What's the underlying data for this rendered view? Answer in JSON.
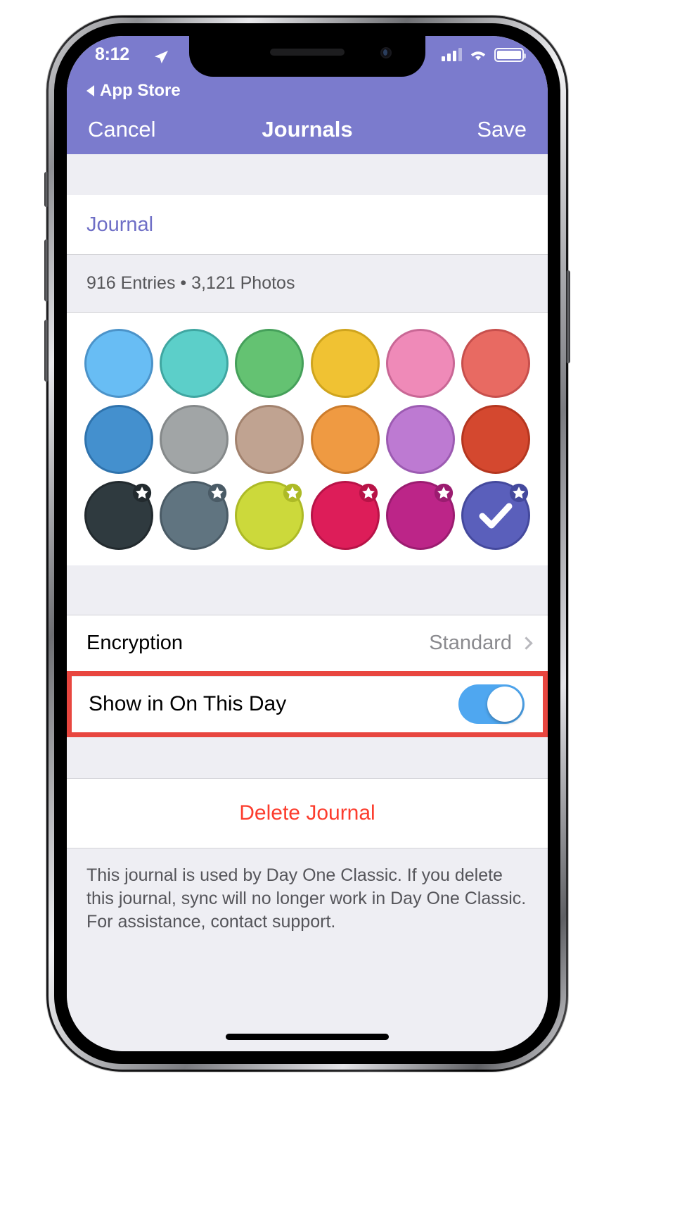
{
  "status_bar": {
    "time": "8:12",
    "location_icon": "location-arrow-icon",
    "signal_icon": "cellular-signal-icon",
    "wifi_icon": "wifi-icon",
    "battery_icon": "battery-full-icon"
  },
  "back_link": {
    "label": "App Store",
    "icon": "back-caret-icon"
  },
  "nav_bar": {
    "cancel_label": "Cancel",
    "title": "Journals",
    "save_label": "Save",
    "background_color": "#7b7bcd"
  },
  "journal": {
    "name": "Journal",
    "name_color": "#6f6fc6",
    "stats": "916 Entries • 3,121 Photos",
    "entries_count": "916",
    "photos_count": "3,121"
  },
  "color_picker": {
    "selected_index": 17,
    "check_icon": "checkmark-icon",
    "swatches": [
      {
        "name": "sky-blue",
        "color": "#68bdf4",
        "border": "#4b93c9",
        "premium": false
      },
      {
        "name": "turquoise",
        "color": "#5ccfc9",
        "border": "#3fa6a1",
        "premium": false
      },
      {
        "name": "green",
        "color": "#64c272",
        "border": "#45a05a",
        "premium": false
      },
      {
        "name": "yellow",
        "color": "#f0c233",
        "border": "#cfa41d",
        "premium": false
      },
      {
        "name": "pink",
        "color": "#ef8ab8",
        "border": "#c96795",
        "premium": false
      },
      {
        "name": "salmon-red",
        "color": "#e86a62",
        "border": "#c74f4c",
        "premium": false
      },
      {
        "name": "blue",
        "color": "#4490ce",
        "border": "#2f73ad",
        "premium": false
      },
      {
        "name": "gray",
        "color": "#a1a5a6",
        "border": "#85898a",
        "premium": false
      },
      {
        "name": "tan",
        "color": "#c0a391",
        "border": "#a2826e",
        "premium": false
      },
      {
        "name": "orange",
        "color": "#ef9a42",
        "border": "#cd7c2b",
        "premium": false
      },
      {
        "name": "light-purple",
        "color": "#bd7ad2",
        "border": "#9c5bb2",
        "premium": false
      },
      {
        "name": "brick-red",
        "color": "#d4482f",
        "border": "#b5361f",
        "premium": false
      },
      {
        "name": "charcoal",
        "color": "#2f3a3f",
        "border": "#222a2e",
        "premium": true
      },
      {
        "name": "slate",
        "color": "#607480",
        "border": "#4a5b66",
        "premium": true
      },
      {
        "name": "lime",
        "color": "#ccd93b",
        "border": "#adba26",
        "premium": true
      },
      {
        "name": "crimson",
        "color": "#dd1d59",
        "border": "#b81347",
        "premium": true
      },
      {
        "name": "magenta",
        "color": "#bc2588",
        "border": "#9b1c70",
        "premium": true
      },
      {
        "name": "indigo",
        "color": "#5a5fbb",
        "border": "#44499d",
        "premium": true
      }
    ]
  },
  "settings": {
    "encryption": {
      "label": "Encryption",
      "value": "Standard",
      "chevron_icon": "chevron-right-icon"
    },
    "show_on_this_day": {
      "label": "Show in On This Day",
      "toggle_state": "on",
      "toggle_color": "#4fa7f0",
      "highlight_color": "#e8463f"
    }
  },
  "delete": {
    "label": "Delete Journal",
    "color": "#fc3d2e"
  },
  "footer": {
    "note": "This journal is used by Day One Classic. If you delete this journal, sync will no longer work in Day One Classic. For assistance, contact support."
  }
}
